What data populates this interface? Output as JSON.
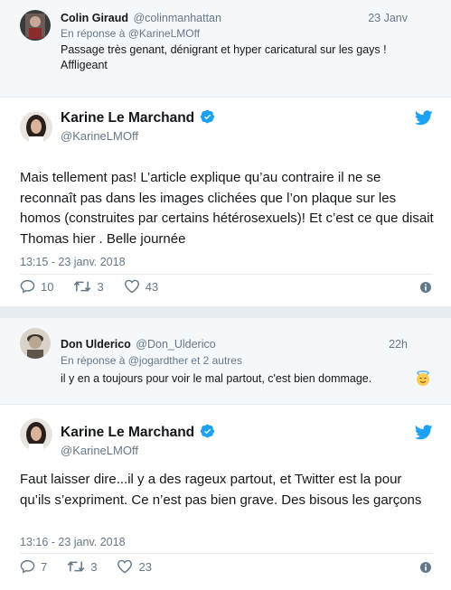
{
  "thread1": {
    "reply": {
      "name": "Colin Giraud",
      "handle": "@colinmanhattan",
      "time": "23 Janv",
      "in_reply_prefix": "En réponse à ",
      "in_reply_to": "@KarineLMOff",
      "text": "Passage très genant, dénigrant et hyper caricatural sur les gays ! Affligeant"
    },
    "tweet": {
      "name": "Karine Le Marchand",
      "handle": "@KarineLMOff",
      "text": "Mais tellement pas! L’article explique qu’au contraire il ne se reconnaît pas dans les images clichées que l’on plaque sur les homos (construites par certains hétérosexuels)! Et c’est ce que disait Thomas hier . Belle journée",
      "timestamp": "13:15 - 23 janv. 2018",
      "replies": "10",
      "retweets": "3",
      "likes": "43"
    }
  },
  "thread2": {
    "reply": {
      "name": "Don Ulderico",
      "handle": "@Don_Ulderico",
      "time": "22h",
      "in_reply_prefix": "En réponse à ",
      "in_reply_to": "@jogardther et 2 autres",
      "text": "il y en a toujours pour voir le mal partout, c'est bien dommage."
    },
    "tweet": {
      "name": "Karine Le Marchand",
      "handle": "@KarineLMOff",
      "text": "Faut laisser dire...il y a des rageux partout, et Twitter est la pour qu’ils s’expriment. Ce n’est pas bien grave. Des bisous les garçons",
      "timestamp": "13:16 - 23 janv. 2018",
      "replies": "7",
      "retweets": "3",
      "likes": "23"
    }
  },
  "colors": {
    "twitter_blue": "#1da1f2",
    "text_gray": "#657786",
    "reply_bg": "#f5f8fa"
  },
  "icons": [
    "reply-icon",
    "retweet-icon",
    "like-icon",
    "info-icon",
    "twitter-bird-icon",
    "verified-badge-icon",
    "angel-emoji-icon"
  ]
}
